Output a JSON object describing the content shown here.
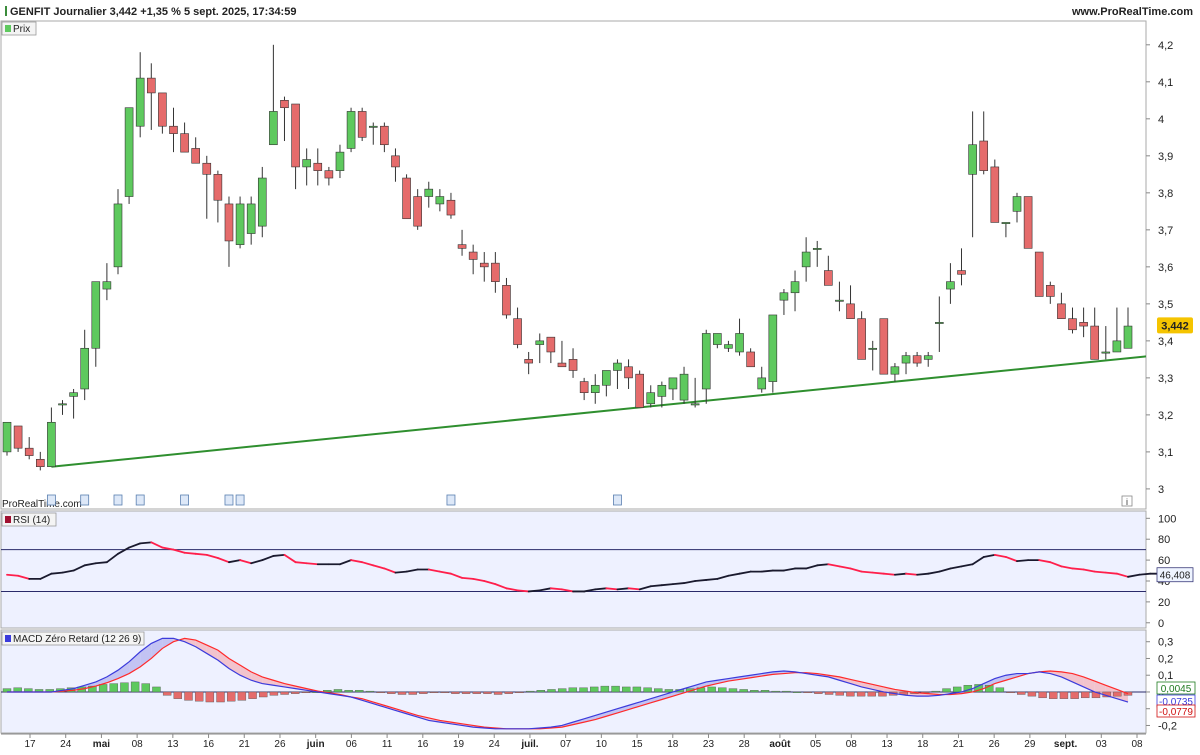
{
  "header": {
    "title": "GENFIT Journalier 3,442 +1,35 % 5 sept. 2025, 17:34:59",
    "site": "www.ProRealTime.com"
  },
  "watermark": "ProRealTime.com",
  "colors": {
    "up": "#5ec95e",
    "down": "#e56b6b",
    "trendline": "#2f8f2f",
    "rsi_up": "#1a1a2e",
    "rsi_down": "#ff1f4b",
    "macd_line": "#3b3bdc",
    "signal_line": "#ff2a2a",
    "panel_bg": "#eef1ff",
    "price_badge": "#f5c400"
  },
  "x_labels": [
    {
      "text": "17",
      "bold": false
    },
    {
      "text": "24",
      "bold": false
    },
    {
      "text": "mai",
      "bold": true
    },
    {
      "text": "08",
      "bold": false
    },
    {
      "text": "13",
      "bold": false
    },
    {
      "text": "16",
      "bold": false
    },
    {
      "text": "21",
      "bold": false
    },
    {
      "text": "26",
      "bold": false
    },
    {
      "text": "juin",
      "bold": true
    },
    {
      "text": "06",
      "bold": false
    },
    {
      "text": "11",
      "bold": false
    },
    {
      "text": "16",
      "bold": false
    },
    {
      "text": "19",
      "bold": false
    },
    {
      "text": "24",
      "bold": false
    },
    {
      "text": "juil.",
      "bold": true
    },
    {
      "text": "07",
      "bold": false
    },
    {
      "text": "10",
      "bold": false
    },
    {
      "text": "15",
      "bold": false
    },
    {
      "text": "18",
      "bold": false
    },
    {
      "text": "23",
      "bold": false
    },
    {
      "text": "28",
      "bold": false
    },
    {
      "text": "août",
      "bold": true
    },
    {
      "text": "05",
      "bold": false
    },
    {
      "text": "08",
      "bold": false
    },
    {
      "text": "13",
      "bold": false
    },
    {
      "text": "18",
      "bold": false
    },
    {
      "text": "21",
      "bold": false
    },
    {
      "text": "26",
      "bold": false
    },
    {
      "text": "29",
      "bold": false
    },
    {
      "text": "sept.",
      "bold": true
    },
    {
      "text": "03",
      "bold": false
    },
    {
      "text": "08",
      "bold": false
    }
  ],
  "chart_data": [
    {
      "type": "candlestick",
      "legend": "Prix",
      "ylim": [
        2.97,
        4.24
      ],
      "yticks": [
        "4,2",
        "4,1",
        "4",
        "3,9",
        "3,8",
        "3,7",
        "3,6",
        "3,5",
        "3,4",
        "3,3",
        "3,2",
        "3,1",
        "3"
      ],
      "ytick_values": [
        4.2,
        4.1,
        4.0,
        3.9,
        3.8,
        3.7,
        3.6,
        3.5,
        3.4,
        3.3,
        3.2,
        3.1,
        3.0
      ],
      "last_value_label": "3,442",
      "last_value": 3.442,
      "ohlc": [
        [
          3.1,
          3.18,
          3.09,
          3.18
        ],
        [
          3.17,
          3.17,
          3.1,
          3.11
        ],
        [
          3.11,
          3.14,
          3.08,
          3.09
        ],
        [
          3.08,
          3.1,
          3.05,
          3.06
        ],
        [
          3.06,
          3.22,
          3.06,
          3.18
        ],
        [
          3.23,
          3.24,
          3.2,
          3.23
        ],
        [
          3.25,
          3.27,
          3.19,
          3.26
        ],
        [
          3.27,
          3.43,
          3.24,
          3.38
        ],
        [
          3.38,
          3.56,
          3.33,
          3.56
        ],
        [
          3.54,
          3.61,
          3.51,
          3.56
        ],
        [
          3.6,
          3.81,
          3.58,
          3.77
        ],
        [
          3.79,
          4.03,
          3.77,
          4.03
        ],
        [
          3.98,
          4.18,
          3.95,
          4.11
        ],
        [
          4.11,
          4.15,
          3.97,
          4.07
        ],
        [
          4.07,
          4.06,
          3.96,
          3.98
        ],
        [
          3.98,
          4.03,
          3.91,
          3.96
        ],
        [
          3.96,
          3.99,
          3.92,
          3.91
        ],
        [
          3.92,
          3.95,
          3.89,
          3.88
        ],
        [
          3.88,
          3.9,
          3.73,
          3.85
        ],
        [
          3.85,
          3.86,
          3.72,
          3.78
        ],
        [
          3.77,
          3.79,
          3.6,
          3.67
        ],
        [
          3.66,
          3.79,
          3.65,
          3.77
        ],
        [
          3.69,
          3.79,
          3.66,
          3.77
        ],
        [
          3.71,
          3.87,
          3.68,
          3.84
        ],
        [
          3.93,
          4.2,
          3.95,
          4.02
        ],
        [
          4.05,
          4.06,
          3.94,
          4.03
        ],
        [
          4.04,
          4.03,
          3.81,
          3.87
        ],
        [
          3.87,
          3.92,
          3.82,
          3.89
        ],
        [
          3.88,
          3.92,
          3.82,
          3.86
        ],
        [
          3.86,
          3.87,
          3.82,
          3.84
        ],
        [
          3.86,
          3.93,
          3.84,
          3.91
        ],
        [
          3.92,
          4.03,
          3.91,
          4.02
        ],
        [
          4.02,
          4.03,
          3.94,
          3.95
        ],
        [
          3.98,
          3.99,
          3.93,
          3.98
        ],
        [
          3.98,
          3.99,
          3.91,
          3.93
        ],
        [
          3.9,
          3.92,
          3.83,
          3.87
        ],
        [
          3.84,
          3.85,
          3.73,
          3.73
        ],
        [
          3.79,
          3.81,
          3.7,
          3.71
        ],
        [
          3.79,
          3.83,
          3.76,
          3.81
        ],
        [
          3.77,
          3.81,
          3.75,
          3.79
        ],
        [
          3.78,
          3.8,
          3.73,
          3.74
        ],
        [
          3.66,
          3.7,
          3.63,
          3.65
        ],
        [
          3.64,
          3.66,
          3.58,
          3.62
        ],
        [
          3.61,
          3.64,
          3.56,
          3.6
        ],
        [
          3.61,
          3.64,
          3.53,
          3.56
        ],
        [
          3.55,
          3.57,
          3.46,
          3.47
        ],
        [
          3.46,
          3.49,
          3.38,
          3.39
        ],
        [
          3.35,
          3.37,
          3.31,
          3.34
        ],
        [
          3.39,
          3.42,
          3.34,
          3.4
        ],
        [
          3.41,
          3.41,
          3.34,
          3.37
        ],
        [
          3.34,
          3.4,
          3.33,
          3.33
        ],
        [
          3.35,
          3.38,
          3.3,
          3.32
        ],
        [
          3.29,
          3.3,
          3.24,
          3.26
        ],
        [
          3.26,
          3.31,
          3.23,
          3.28
        ],
        [
          3.28,
          3.32,
          3.25,
          3.32
        ],
        [
          3.32,
          3.35,
          3.27,
          3.34
        ],
        [
          3.33,
          3.35,
          3.27,
          3.3
        ],
        [
          3.31,
          3.32,
          3.22,
          3.22
        ],
        [
          3.23,
          3.28,
          3.22,
          3.26
        ],
        [
          3.25,
          3.29,
          3.22,
          3.28
        ],
        [
          3.27,
          3.3,
          3.24,
          3.3
        ],
        [
          3.24,
          3.33,
          3.23,
          3.31
        ],
        [
          3.23,
          3.3,
          3.22,
          3.23
        ],
        [
          3.27,
          3.43,
          3.23,
          3.42
        ],
        [
          3.39,
          3.42,
          3.38,
          3.42
        ],
        [
          3.38,
          3.4,
          3.37,
          3.39
        ],
        [
          3.37,
          3.46,
          3.36,
          3.42
        ],
        [
          3.37,
          3.38,
          3.33,
          3.33
        ],
        [
          3.27,
          3.33,
          3.26,
          3.3
        ],
        [
          3.29,
          3.47,
          3.26,
          3.47
        ],
        [
          3.51,
          3.54,
          3.47,
          3.53
        ],
        [
          3.53,
          3.59,
          3.48,
          3.56
        ],
        [
          3.6,
          3.68,
          3.56,
          3.64
        ],
        [
          3.65,
          3.67,
          3.6,
          3.65
        ],
        [
          3.59,
          3.63,
          3.55,
          3.55
        ],
        [
          3.51,
          3.56,
          3.48,
          3.51
        ],
        [
          3.5,
          3.55,
          3.47,
          3.46
        ],
        [
          3.46,
          3.48,
          3.35,
          3.35
        ],
        [
          3.38,
          3.4,
          3.32,
          3.38
        ],
        [
          3.46,
          3.46,
          3.34,
          3.31
        ],
        [
          3.31,
          3.34,
          3.29,
          3.33
        ],
        [
          3.34,
          3.37,
          3.31,
          3.36
        ],
        [
          3.36,
          3.37,
          3.33,
          3.34
        ],
        [
          3.35,
          3.37,
          3.33,
          3.36
        ],
        [
          3.45,
          3.52,
          3.37,
          3.45
        ],
        [
          3.54,
          3.61,
          3.5,
          3.56
        ],
        [
          3.59,
          3.65,
          3.55,
          3.58
        ],
        [
          3.85,
          4.02,
          3.68,
          3.93
        ],
        [
          3.94,
          4.02,
          3.85,
          3.86
        ],
        [
          3.87,
          3.89,
          3.75,
          3.72
        ],
        [
          3.72,
          3.72,
          3.68,
          3.72
        ],
        [
          3.75,
          3.8,
          3.72,
          3.79
        ],
        [
          3.79,
          3.79,
          3.69,
          3.65
        ],
        [
          3.64,
          3.64,
          3.52,
          3.52
        ],
        [
          3.55,
          3.56,
          3.5,
          3.52
        ],
        [
          3.5,
          3.53,
          3.46,
          3.46
        ],
        [
          3.46,
          3.49,
          3.42,
          3.43
        ],
        [
          3.45,
          3.49,
          3.41,
          3.44
        ],
        [
          3.44,
          3.49,
          3.35,
          3.35
        ],
        [
          3.37,
          3.44,
          3.35,
          3.37
        ],
        [
          3.37,
          3.49,
          3.37,
          3.4
        ],
        [
          3.38,
          3.49,
          3.38,
          3.44
        ]
      ],
      "trendline": {
        "start_index": 4,
        "start_value": 3.06,
        "end_value": 3.358
      }
    },
    {
      "type": "line",
      "legend": "RSI (14)",
      "ylim": [
        -5,
        107
      ],
      "yticks": [
        "100",
        "80",
        "60",
        "40",
        "20",
        "0"
      ],
      "ytick_values": [
        100,
        80,
        60,
        40,
        20,
        0
      ],
      "levels": [
        70,
        30
      ],
      "last_value_label": "46,408",
      "values": [
        46,
        45,
        42,
        42,
        47,
        48,
        50,
        55,
        57,
        58,
        66,
        72,
        76,
        77,
        72,
        70,
        67,
        66,
        65,
        62,
        58,
        60,
        57,
        60,
        64,
        65,
        58,
        57,
        56,
        56,
        56,
        60,
        58,
        55,
        52,
        48,
        49,
        51,
        51,
        49,
        47,
        43,
        42,
        40,
        37,
        33,
        31,
        30,
        31,
        33,
        32,
        30,
        30,
        32,
        33,
        32,
        33,
        32,
        35,
        36,
        37,
        38,
        40,
        41,
        42,
        45,
        47,
        49,
        49,
        50,
        50,
        52,
        52,
        55,
        56,
        54,
        52,
        49,
        48,
        47,
        46,
        47,
        46,
        47,
        49,
        52,
        54,
        56,
        63,
        65,
        63,
        59,
        60,
        60,
        58,
        54,
        52,
        51,
        49,
        48,
        47,
        44,
        46,
        47,
        47,
        46
      ]
    },
    {
      "type": "bar+line",
      "legend": "MACD Zéro Retard (12 26 9)",
      "ylim": [
        -0.245,
        0.37
      ],
      "yticks": [
        "0,3",
        "0,2",
        "0,1",
        "0",
        "-0,1",
        "-0,2"
      ],
      "ytick_values": [
        0.3,
        0.2,
        0.1,
        0,
        -0.1,
        -0.2
      ],
      "last_value_labels": [
        "0,0045",
        "-0,0735",
        "-0,0779"
      ],
      "histogram": [
        0.02,
        0.025,
        0.02,
        0.015,
        0.015,
        0.02,
        0.025,
        0.03,
        0.035,
        0.045,
        0.05,
        0.055,
        0.06,
        0.05,
        0.03,
        -0.02,
        -0.04,
        -0.05,
        -0.055,
        -0.06,
        -0.06,
        -0.055,
        -0.05,
        -0.04,
        -0.03,
        -0.02,
        -0.015,
        -0.01,
        -0.005,
        0.0,
        0.01,
        0.015,
        0.01,
        0.01,
        0.005,
        -0.005,
        -0.01,
        -0.015,
        -0.015,
        -0.01,
        -0.005,
        -0.005,
        -0.01,
        -0.01,
        -0.01,
        -0.01,
        -0.015,
        -0.01,
        -0.005,
        0.005,
        0.01,
        0.015,
        0.02,
        0.025,
        0.025,
        0.03,
        0.035,
        0.035,
        0.03,
        0.03,
        0.025,
        0.02,
        0.015,
        0.015,
        0.02,
        0.025,
        0.03,
        0.025,
        0.02,
        0.015,
        0.01,
        0.01,
        0.005,
        0.005,
        0.0,
        -0.005,
        -0.01,
        -0.015,
        -0.02,
        -0.025,
        -0.025,
        -0.025,
        -0.025,
        -0.02,
        -0.015,
        -0.01,
        -0.005,
        0.005,
        0.02,
        0.03,
        0.04,
        0.045,
        0.04,
        0.025,
        -0.005,
        -0.015,
        -0.025,
        -0.035,
        -0.04,
        -0.04,
        -0.04,
        -0.035,
        -0.035,
        -0.03,
        -0.025,
        -0.02
      ],
      "macd": [
        0.0,
        0.0,
        0.0,
        0.0,
        0.0,
        0.01,
        0.02,
        0.04,
        0.06,
        0.09,
        0.13,
        0.18,
        0.24,
        0.29,
        0.32,
        0.32,
        0.3,
        0.27,
        0.23,
        0.19,
        0.14,
        0.1,
        0.07,
        0.05,
        0.04,
        0.03,
        0.02,
        0.01,
        0.0,
        -0.01,
        -0.02,
        -0.03,
        -0.05,
        -0.07,
        -0.09,
        -0.11,
        -0.13,
        -0.15,
        -0.17,
        -0.18,
        -0.19,
        -0.2,
        -0.21,
        -0.215,
        -0.22,
        -0.22,
        -0.22,
        -0.22,
        -0.215,
        -0.21,
        -0.2,
        -0.18,
        -0.16,
        -0.14,
        -0.12,
        -0.1,
        -0.08,
        -0.06,
        -0.04,
        -0.02,
        0.0,
        0.02,
        0.04,
        0.06,
        0.07,
        0.08,
        0.09,
        0.1,
        0.11,
        0.12,
        0.125,
        0.12,
        0.11,
        0.1,
        0.09,
        0.07,
        0.05,
        0.03,
        0.015,
        0.0,
        -0.01,
        -0.02,
        -0.025,
        -0.025,
        -0.02,
        -0.01,
        0.0,
        0.02,
        0.05,
        0.08,
        0.1,
        0.11,
        0.11,
        0.12,
        0.11,
        0.09,
        0.06,
        0.03,
        0.0,
        -0.02,
        -0.04,
        -0.06,
        -0.07,
        -0.075,
        -0.08,
        -0.078
      ],
      "signal": [
        0.0,
        0.0,
        0.0,
        0.0,
        0.0,
        0.005,
        0.01,
        0.02,
        0.035,
        0.055,
        0.08,
        0.11,
        0.15,
        0.2,
        0.26,
        0.3,
        0.32,
        0.31,
        0.28,
        0.25,
        0.2,
        0.16,
        0.12,
        0.09,
        0.07,
        0.05,
        0.035,
        0.02,
        0.005,
        -0.005,
        -0.015,
        -0.03,
        -0.04,
        -0.06,
        -0.08,
        -0.1,
        -0.12,
        -0.14,
        -0.155,
        -0.17,
        -0.18,
        -0.19,
        -0.2,
        -0.21,
        -0.215,
        -0.22,
        -0.22,
        -0.22,
        -0.22,
        -0.215,
        -0.21,
        -0.195,
        -0.18,
        -0.165,
        -0.145,
        -0.125,
        -0.105,
        -0.085,
        -0.065,
        -0.045,
        -0.025,
        -0.005,
        0.015,
        0.035,
        0.05,
        0.065,
        0.075,
        0.085,
        0.095,
        0.105,
        0.11,
        0.115,
        0.115,
        0.11,
        0.1,
        0.09,
        0.075,
        0.06,
        0.045,
        0.03,
        0.015,
        0.005,
        -0.005,
        -0.01,
        -0.015,
        -0.015,
        -0.01,
        0.0,
        0.02,
        0.05,
        0.07,
        0.09,
        0.11,
        0.12,
        0.125,
        0.12,
        0.11,
        0.09,
        0.065,
        0.04,
        0.015,
        -0.01,
        -0.03,
        -0.05,
        -0.06,
        -0.07
      ]
    }
  ]
}
